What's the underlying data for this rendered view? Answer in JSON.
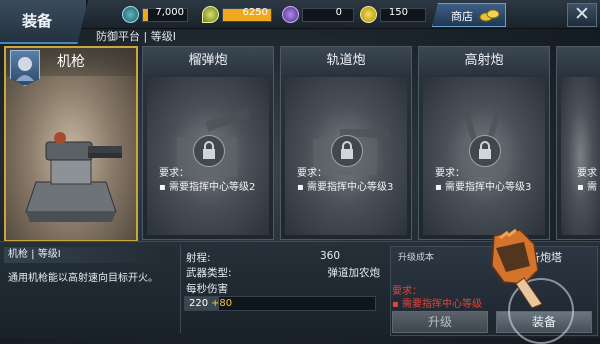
{
  "header": {
    "tab_label": "装备",
    "shop_label": "商店",
    "resources": [
      {
        "icon": "gear-energy-icon",
        "value": "7,000",
        "fill": 0.12,
        "color": "#f0a91c"
      },
      {
        "icon": "oil-drop-icon",
        "value": "6250",
        "fill": 1.0,
        "color": "#f0a91c"
      },
      {
        "icon": "crystal-icon",
        "value": "0",
        "fill": 0.0,
        "color": "#8b5fd6"
      },
      {
        "icon": "coin-icon",
        "value": "150",
        "fill": 0.0,
        "color": "#f0a91c"
      }
    ]
  },
  "subtitle": "防御平台 | 等级I",
  "cards": [
    {
      "name": "机枪",
      "selected": true,
      "locked": false
    },
    {
      "name": "榴弹炮",
      "selected": false,
      "locked": true,
      "req_title": "要求：",
      "req_item": "▪ 需要指挥中心等级2"
    },
    {
      "name": "轨道炮",
      "selected": false,
      "locked": true,
      "req_title": "要求：",
      "req_item": "▪ 需要指挥中心等级3"
    },
    {
      "name": "高射炮",
      "selected": false,
      "locked": true,
      "req_title": "要求：",
      "req_item": "▪ 需要指挥中心等级3"
    },
    {
      "name": "",
      "selected": false,
      "locked": true,
      "req_title": "要求",
      "req_item": "▪ 需"
    }
  ],
  "info": {
    "title": "机枪 | 等级I",
    "description": "通用机枪能以高射速向目标开火。"
  },
  "stats": {
    "range_label": "射程:",
    "range_value": "360",
    "weapon_type_label": "武器类型:",
    "weapon_type_value": "弹道加农炮",
    "dps_label": "每秒伤害",
    "dps_base": "220",
    "dps_bonus": "+80",
    "dps_fill": 0.18
  },
  "action_panel": {
    "cost_label": "升级成本",
    "equip_title": "装备炮塔",
    "req_title": "要求：",
    "req_item": "▪ 需要指挥中心等级",
    "upgrade_button": "升级",
    "equip_button": "装备"
  }
}
